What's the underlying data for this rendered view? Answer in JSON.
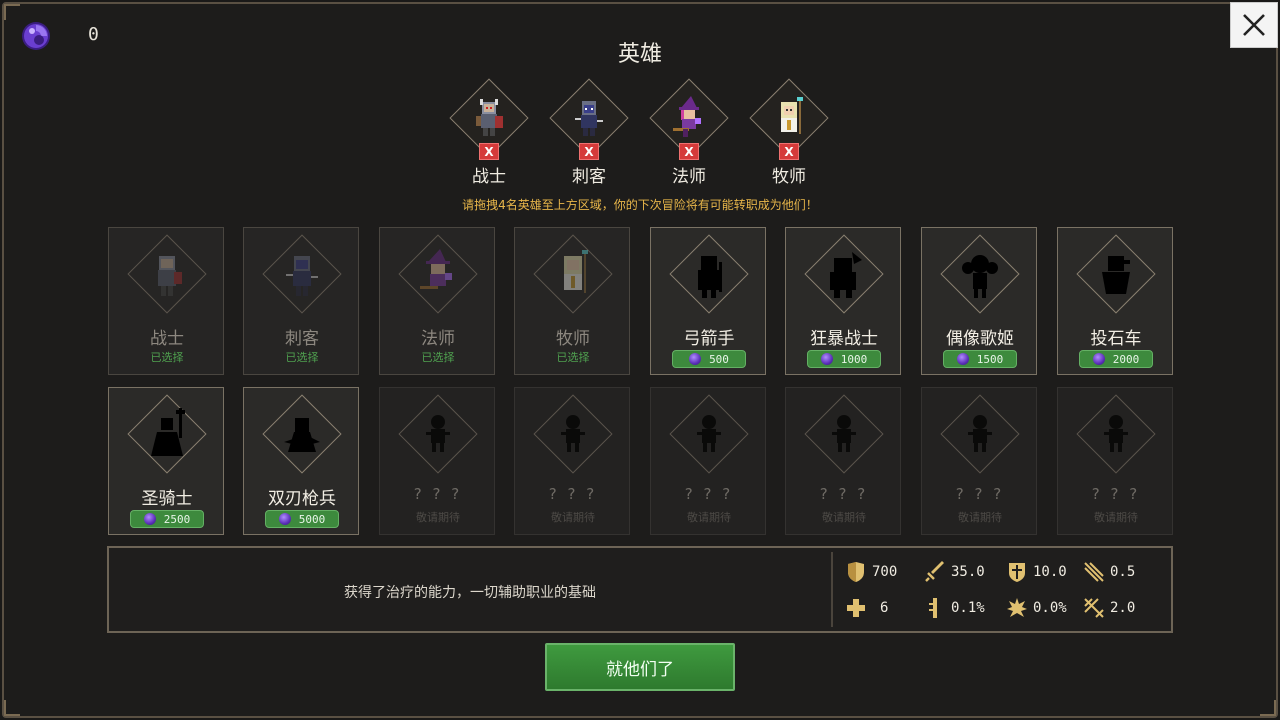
{
  "currency": {
    "icon": "purple-gem-icon",
    "value": "0"
  },
  "close_label": "X",
  "title": "英雄",
  "selected_heroes": [
    {
      "name": "战士",
      "remove_label": "X"
    },
    {
      "name": "刺客",
      "remove_label": "X"
    },
    {
      "name": "法师",
      "remove_label": "X"
    },
    {
      "name": "牧师",
      "remove_label": "X"
    }
  ],
  "hint": "请拖拽4名英雄至上方区域，你的下次冒险将有可能转职成为他们！",
  "heroes": [
    {
      "name": "战士",
      "status": "已选择",
      "state": "owned"
    },
    {
      "name": "刺客",
      "status": "已选择",
      "state": "owned"
    },
    {
      "name": "法师",
      "status": "已选择",
      "state": "owned"
    },
    {
      "name": "牧师",
      "status": "已选择",
      "state": "owned"
    },
    {
      "name": "弓箭手",
      "price": "500",
      "state": "buy"
    },
    {
      "name": "狂暴战士",
      "price": "1000",
      "state": "buy"
    },
    {
      "name": "偶像歌姬",
      "price": "1500",
      "state": "buy"
    },
    {
      "name": "投石车",
      "price": "2000",
      "state": "buy"
    },
    {
      "name": "圣骑士",
      "price": "2500",
      "state": "buy"
    },
    {
      "name": "双刃枪兵",
      "price": "5000",
      "state": "buy"
    },
    {
      "name": "? ? ?",
      "status": "敬请期待",
      "state": "locked"
    },
    {
      "name": "? ? ?",
      "status": "敬请期待",
      "state": "locked"
    },
    {
      "name": "? ? ?",
      "status": "敬请期待",
      "state": "locked"
    },
    {
      "name": "? ? ?",
      "status": "敬请期待",
      "state": "locked"
    },
    {
      "name": "? ? ?",
      "status": "敬请期待",
      "state": "locked"
    },
    {
      "name": "? ? ?",
      "status": "敬请期待",
      "state": "locked"
    }
  ],
  "info": {
    "description": "获得了治疗的能力，一切辅助职业的基础",
    "stats": [
      {
        "icon": "shield-icon",
        "value": "700"
      },
      {
        "icon": "sword-icon",
        "value": "35.0"
      },
      {
        "icon": "armor-icon",
        "value": "10.0"
      },
      {
        "icon": "attack-speed-icon",
        "value": "0.5"
      },
      {
        "icon": "heal-cross-icon",
        "value": "6"
      },
      {
        "icon": "crit-chance-icon",
        "value": "0.1%"
      },
      {
        "icon": "dodge-icon",
        "value": "0.0%"
      },
      {
        "icon": "range-icon",
        "value": "2.0"
      }
    ]
  },
  "confirm_label": "就他们了"
}
